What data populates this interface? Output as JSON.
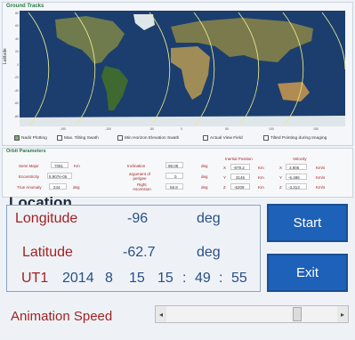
{
  "ground_tracks": {
    "title": "Ground Tracks",
    "y_label": "Latitude",
    "lat_ticks": [
      "80",
      "60",
      "40",
      "20",
      "0",
      "-20",
      "-40",
      "-60",
      "-80"
    ],
    "lon_ticks": [
      "-150",
      "-100",
      "-50",
      "0",
      "50",
      "100",
      "150"
    ],
    "checkboxes": [
      {
        "label": "Nadir Plotting",
        "checked": true
      },
      {
        "label": "Max. Tilting Swath",
        "checked": false
      },
      {
        "label": "Min Horizon Elevation Swath",
        "checked": false
      },
      {
        "label": "Actual View Field",
        "checked": false
      },
      {
        "label": "Tilted Pointing during Imaging",
        "checked": false
      }
    ]
  },
  "orbit": {
    "title": "Orbit Parameters",
    "semi_major": {
      "label": "Semi Major",
      "value": "7081",
      "unit": "Km"
    },
    "eccentricity": {
      "label": "Eccentricity",
      "value": "8.907e-05"
    },
    "true_anomaly": {
      "label": "True Anomaly",
      "value": "244",
      "unit": "deg"
    },
    "inclination": {
      "label": "Inclination",
      "value": "98.08",
      "unit": "deg"
    },
    "arg_perigee": {
      "label": "argument of\nperigee",
      "value": "0",
      "unit": "deg"
    },
    "raan": {
      "label": "Right\nAscension",
      "value": "58.8",
      "unit": "deg"
    },
    "inertial": {
      "label": "Inertial Position",
      "rows": [
        {
          "axis": "X",
          "value": "-879.2",
          "unit": "Km"
        },
        {
          "axis": "Y",
          "value": "3146",
          "unit": "Km"
        },
        {
          "axis": "Z",
          "value": "-6209",
          "unit": "Km"
        }
      ]
    },
    "velocity": {
      "label": "Velocity",
      "rows": [
        {
          "axis": "X",
          "value": "3.906",
          "unit": "Km/s"
        },
        {
          "axis": "Y",
          "value": "-5.486",
          "unit": "Km/s"
        },
        {
          "axis": "Z",
          "value": "-3.313",
          "unit": "Km/s"
        }
      ]
    }
  },
  "location": {
    "title": "Location",
    "longitude": {
      "label": "Longitude",
      "value": "-96",
      "unit": "deg"
    },
    "latitude": {
      "label": "Latitude",
      "value": "-62.7",
      "unit": "deg"
    },
    "ut1": {
      "label": "UT1",
      "year": "2014",
      "month": "8",
      "day": "15",
      "hour": "15",
      "minute": "49",
      "second": "55",
      "sep": ":"
    }
  },
  "buttons": {
    "start": "Start",
    "exit": "Exit"
  },
  "animation": {
    "label": "Animation Speed",
    "left_arrow": "◂",
    "right_arrow": "▸",
    "speed_fraction": 0.78
  },
  "colors": {
    "button": "#1d61b8",
    "label_red": "#a22222",
    "value_blue": "#2a4f86",
    "track": "#e7e98a"
  }
}
